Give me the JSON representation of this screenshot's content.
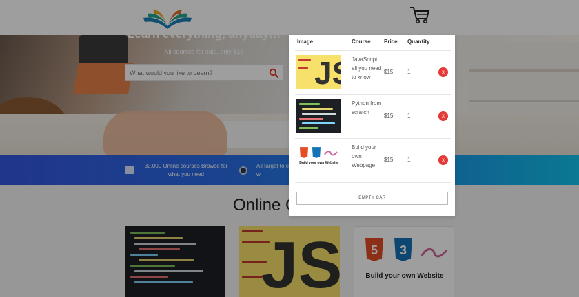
{
  "header": {
    "logo_icon": "open-book-logo",
    "cart_icon": "shopping-cart-icon"
  },
  "hero": {
    "title": "Learn everything, anyday!!!",
    "subtitle": "All courses for sale, only $15",
    "search_placeholder": "What would you like to Learn?",
    "search_icon": "search-icon"
  },
  "banner": {
    "item1": "30,000 Online courses Browse for what you need",
    "item2": "All target to easy w"
  },
  "courses_section": {
    "heading": "Online C",
    "cards": [
      {
        "image": "python-code-screenshot"
      },
      {
        "image": "javascript-logo",
        "logo_text": "JS"
      },
      {
        "image": "html5-css3-sass-logos",
        "logo_text": "Build your own Website",
        "badges": [
          "HTML",
          "CSS",
          "Sass"
        ]
      }
    ]
  },
  "cart": {
    "headers": {
      "image": "Image",
      "course": "Course",
      "price": "Price",
      "quantity": "Quantity"
    },
    "items": [
      {
        "course": "JavaScript all you need to know",
        "price": "$15",
        "quantity": "1",
        "remove": "x",
        "thumb": "JS"
      },
      {
        "course": "Python from scratch",
        "price": "$15",
        "quantity": "1",
        "remove": "x",
        "thumb": "python-code"
      },
      {
        "course": "Build your own Webpage",
        "price": "$15",
        "quantity": "1",
        "remove": "x",
        "thumb": "Build your own Website"
      }
    ],
    "empty_label": "EMPTY CAR"
  }
}
